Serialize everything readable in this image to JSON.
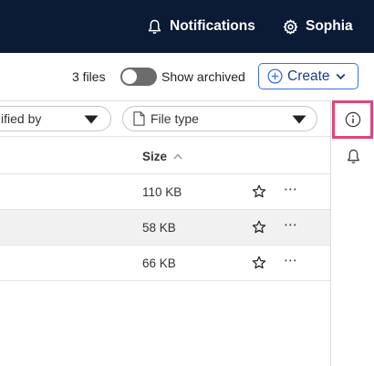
{
  "header": {
    "notifications_label": "Notifications",
    "user_name": "Sophia"
  },
  "toolbar": {
    "files_count": "3 files",
    "show_archived_label": "Show archived",
    "show_archived_on": false,
    "create_label": "Create"
  },
  "filters": {
    "modified_by_label": "ified by",
    "file_type_label": "File type"
  },
  "table": {
    "size_header": "Size",
    "rows": [
      {
        "size": "110 KB",
        "more": "⋯"
      },
      {
        "size": "58 KB",
        "more": "⋯"
      },
      {
        "size": "66 KB",
        "more": "⋯"
      }
    ]
  },
  "colors": {
    "topbar": "#0b1a35",
    "accent": "#3c6fe3",
    "highlight": "#e0457b"
  },
  "icons": [
    "bell-icon",
    "gear-icon",
    "plus-circle-icon",
    "chevron-down-icon",
    "document-icon",
    "caret-down-icon",
    "sort-up-icon",
    "star-icon",
    "more-icon",
    "info-icon"
  ]
}
